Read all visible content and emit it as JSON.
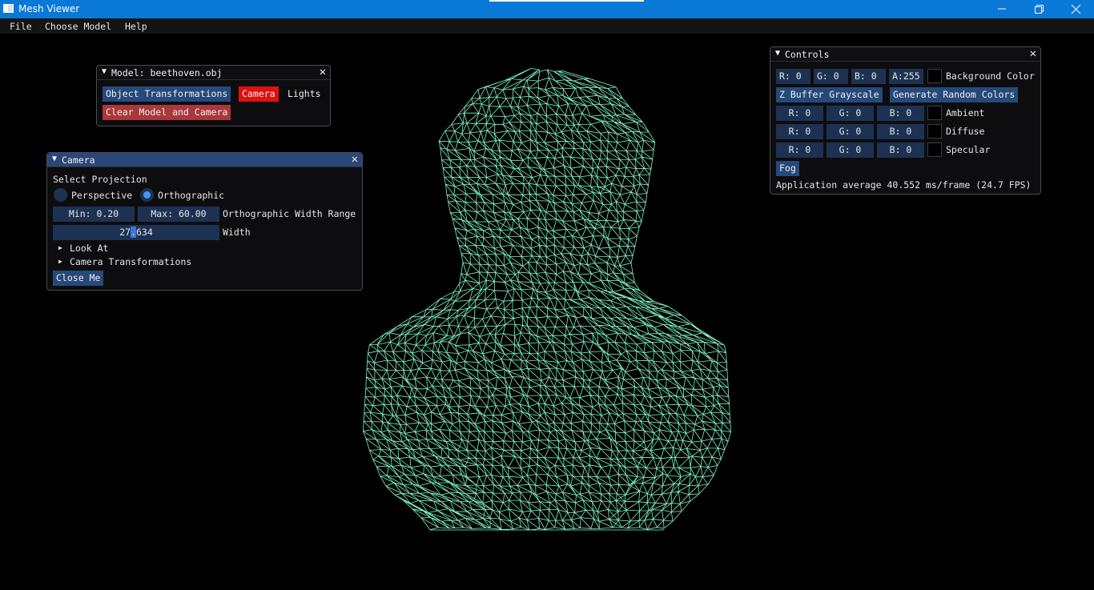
{
  "window": {
    "title": "Mesh Viewer",
    "controls": [
      "minimize-icon",
      "restore-icon",
      "close-icon"
    ]
  },
  "menubar": [
    "File",
    "Choose Model",
    "Help"
  ],
  "model_window": {
    "title": "Model: beethoven.obj",
    "tabs": [
      "Object Transformations",
      "Camera",
      "Lights"
    ],
    "active_tab": "Camera",
    "clear_button": "Clear Model and Camera"
  },
  "camera_window": {
    "title": "Camera",
    "section_label": "Select Projection",
    "projection_options": [
      "Perspective",
      "Orthographic"
    ],
    "selected_projection": "Orthographic",
    "range_min": "Min: 0.20",
    "range_max": "Max: 60.00",
    "range_label": "Orthographic Width Range",
    "width_value": "27.634",
    "width_value_parts": [
      "27",
      ".",
      "634"
    ],
    "width_label": "Width",
    "tree_nodes": [
      "Look At",
      "Camera Transformations"
    ],
    "close_button": "Close Me"
  },
  "controls_window": {
    "title": "Controls",
    "background": {
      "r": "R:  0",
      "g": "G:  0",
      "b": "B:  0",
      "a": "A:255",
      "label": "Background Color",
      "color": "#000000"
    },
    "buttons": [
      "Z Buffer Grayscale",
      "Generate Random Colors"
    ],
    "ambient": {
      "r": "R:  0",
      "g": "G:  0",
      "b": "B:  0",
      "label": "Ambient",
      "color": "#000000"
    },
    "diffuse": {
      "r": "R:  0",
      "g": "G:  0",
      "b": "B:  0",
      "label": "Diffuse",
      "color": "#000000"
    },
    "specular": {
      "r": "R:  0",
      "g": "G:  0",
      "b": "B:  0",
      "label": "Specular",
      "color": "#000000"
    },
    "fog_button": "Fog",
    "stats": "Application average 40.552 ms/frame (24.7 FPS)"
  },
  "colors": {
    "accent_blue": "#26497a",
    "active_tab": "#e01010",
    "clear_button": "#a8383c",
    "mesh": "#7ff5c8",
    "titlebar": "#0a78d7"
  }
}
